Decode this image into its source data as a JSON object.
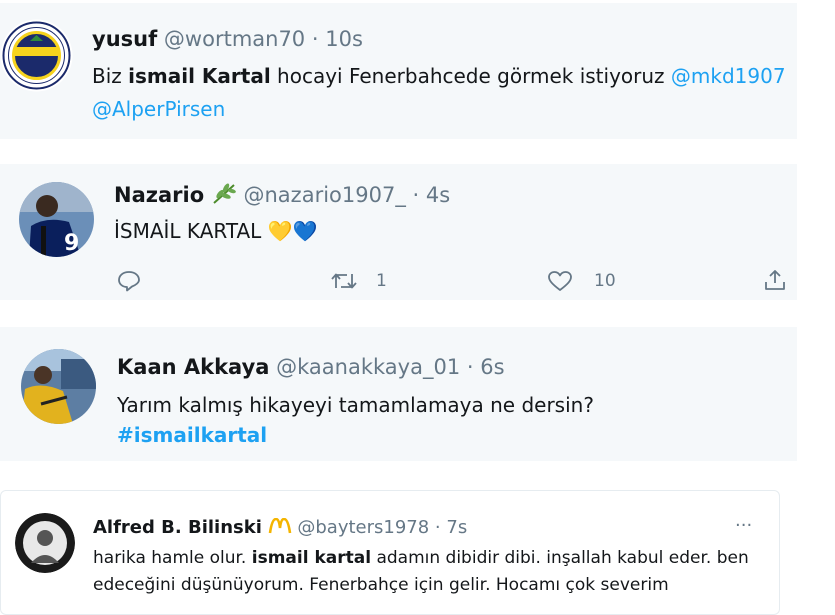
{
  "tweet1": {
    "name": "yusuf",
    "handle": "@wortman70",
    "sep": "·",
    "time": "10s",
    "text_pre": "Biz ",
    "text_bold": "ismail Kartal",
    "text_post": " hocayi Fenerbahcede görmek istiyoruz ",
    "mention1": "@mkd1907",
    "mention2": "@AlperPirsen",
    "avatar_text_top": "FENERBAHÇE SPOR KULÜBÜ",
    "avatar_text_year": "1907"
  },
  "tweet2": {
    "name": "Nazario",
    "badge_icon": "olive-branch-icon",
    "handle": "@nazario1907_",
    "sep": "·",
    "time": "4s",
    "text": "İSMAİL KARTAL",
    "emoji": "💛💙",
    "reply_icon": "reply-icon",
    "retweet_icon": "retweet-icon",
    "retweet_count": "1",
    "like_icon": "heart-icon",
    "like_count": "10",
    "share_icon": "share-icon"
  },
  "tweet3": {
    "name": "Kaan Akkaya",
    "handle": "@kaanakkaya_01",
    "sep": "·",
    "time": "6s",
    "text": "Yarım kalmış hikayeyi tamamlamaya ne dersin?",
    "hashtag": "#ismailkartal"
  },
  "tweet4": {
    "name": "Alfred B. Bilinski",
    "badge_icon": "yellow-m-logo-icon",
    "handle": "@bayters1978",
    "sep": "·",
    "time": "7s",
    "more": "···",
    "line1_pre": "harika hamle olur. ",
    "line1_bold": "ismail kartal",
    "line1_post": " adamın dibidir dibi. inşallah kabul eder. ben",
    "line2": "edeceğini düşünüyorum. Fenerbahçe için gelir. Hocamı çok severim"
  },
  "colors": {
    "card_bg": "#f5f8fa",
    "link": "#1da1f2",
    "muted": "#657786",
    "fb_navy": "#1b2a6b",
    "fb_yellow": "#f6d31d"
  }
}
